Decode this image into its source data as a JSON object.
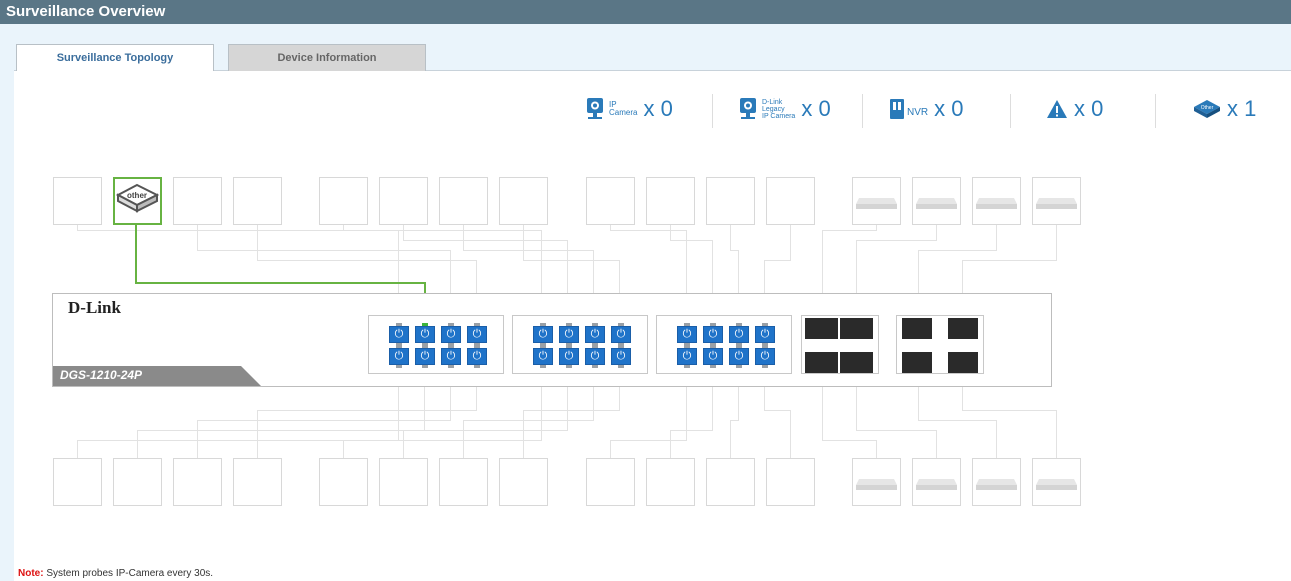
{
  "window": {
    "title": "Surveillance Overview"
  },
  "tabs": [
    {
      "label": "Surveillance Topology",
      "active": true
    },
    {
      "label": "Device Information",
      "active": false
    }
  ],
  "legend": {
    "ip_camera": {
      "label_line1": "IP",
      "label_line2": "Camera",
      "count": "x 0"
    },
    "legacy_camera": {
      "label_line1": "D-Link",
      "label_line2": "Legacy",
      "label_line3": "IP Camera",
      "count": "x 0"
    },
    "nvr": {
      "label": "NVR",
      "count": "x 0"
    },
    "warning": {
      "count": "x 0"
    },
    "other": {
      "label": "Other",
      "count": "x 1"
    }
  },
  "switch": {
    "brand": "D-Link",
    "model": "DGS-1210-24P"
  },
  "device_other": {
    "label": "other"
  },
  "note": {
    "prefix": "Note:",
    "text": " System probes IP-Camera every 30s."
  },
  "colors": {
    "accent": "#2a7ab9",
    "title_bar": "#5a7686",
    "link_active": "#67b342",
    "port": "#1f73c9"
  }
}
